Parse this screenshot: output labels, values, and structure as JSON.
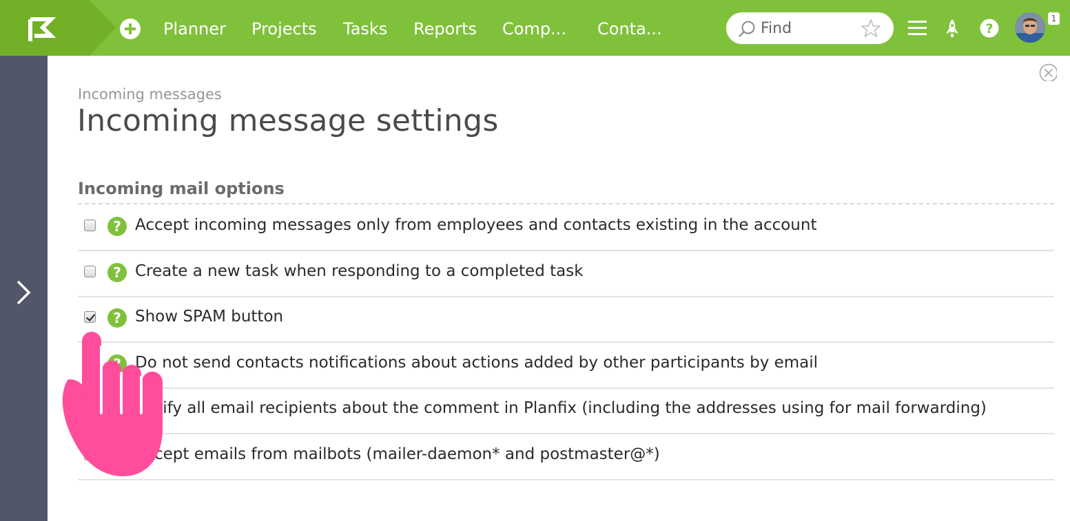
{
  "header": {
    "nav": [
      {
        "label": "Planner"
      },
      {
        "label": "Projects"
      },
      {
        "label": "Tasks"
      },
      {
        "label": "Reports"
      },
      {
        "label": "Comp..."
      },
      {
        "label": "Conta..."
      }
    ],
    "search": {
      "placeholder": "Find",
      "value": ""
    },
    "notification_count": "1",
    "icons": [
      "logo-flag-icon",
      "add-icon",
      "search-icon",
      "star-icon",
      "menu-icon",
      "rocket-icon",
      "help-icon",
      "avatar"
    ]
  },
  "colors": {
    "brand_green": "#80c13c",
    "sidebar": "#52566a",
    "hand_pointer": "#ff4d9b"
  },
  "page": {
    "breadcrumb": "Incoming messages",
    "title": "Incoming message settings",
    "section": "Incoming mail options"
  },
  "options": [
    {
      "label": "Accept incoming messages only from employees and contacts existing in the account",
      "checked": false
    },
    {
      "label": "Create a new task when responding to a completed task",
      "checked": false
    },
    {
      "label": "Show SPAM button",
      "checked": true
    },
    {
      "label": "Do not send contacts notifications about actions added by other participants by email",
      "checked": false
    },
    {
      "label": "Notify all email recipients about the comment in Planfix (including the addresses using for mail forwarding)",
      "checked": false
    },
    {
      "label": "Accept emails from mailbots (mailer-daemon* and postmaster@*)",
      "checked": false
    }
  ]
}
